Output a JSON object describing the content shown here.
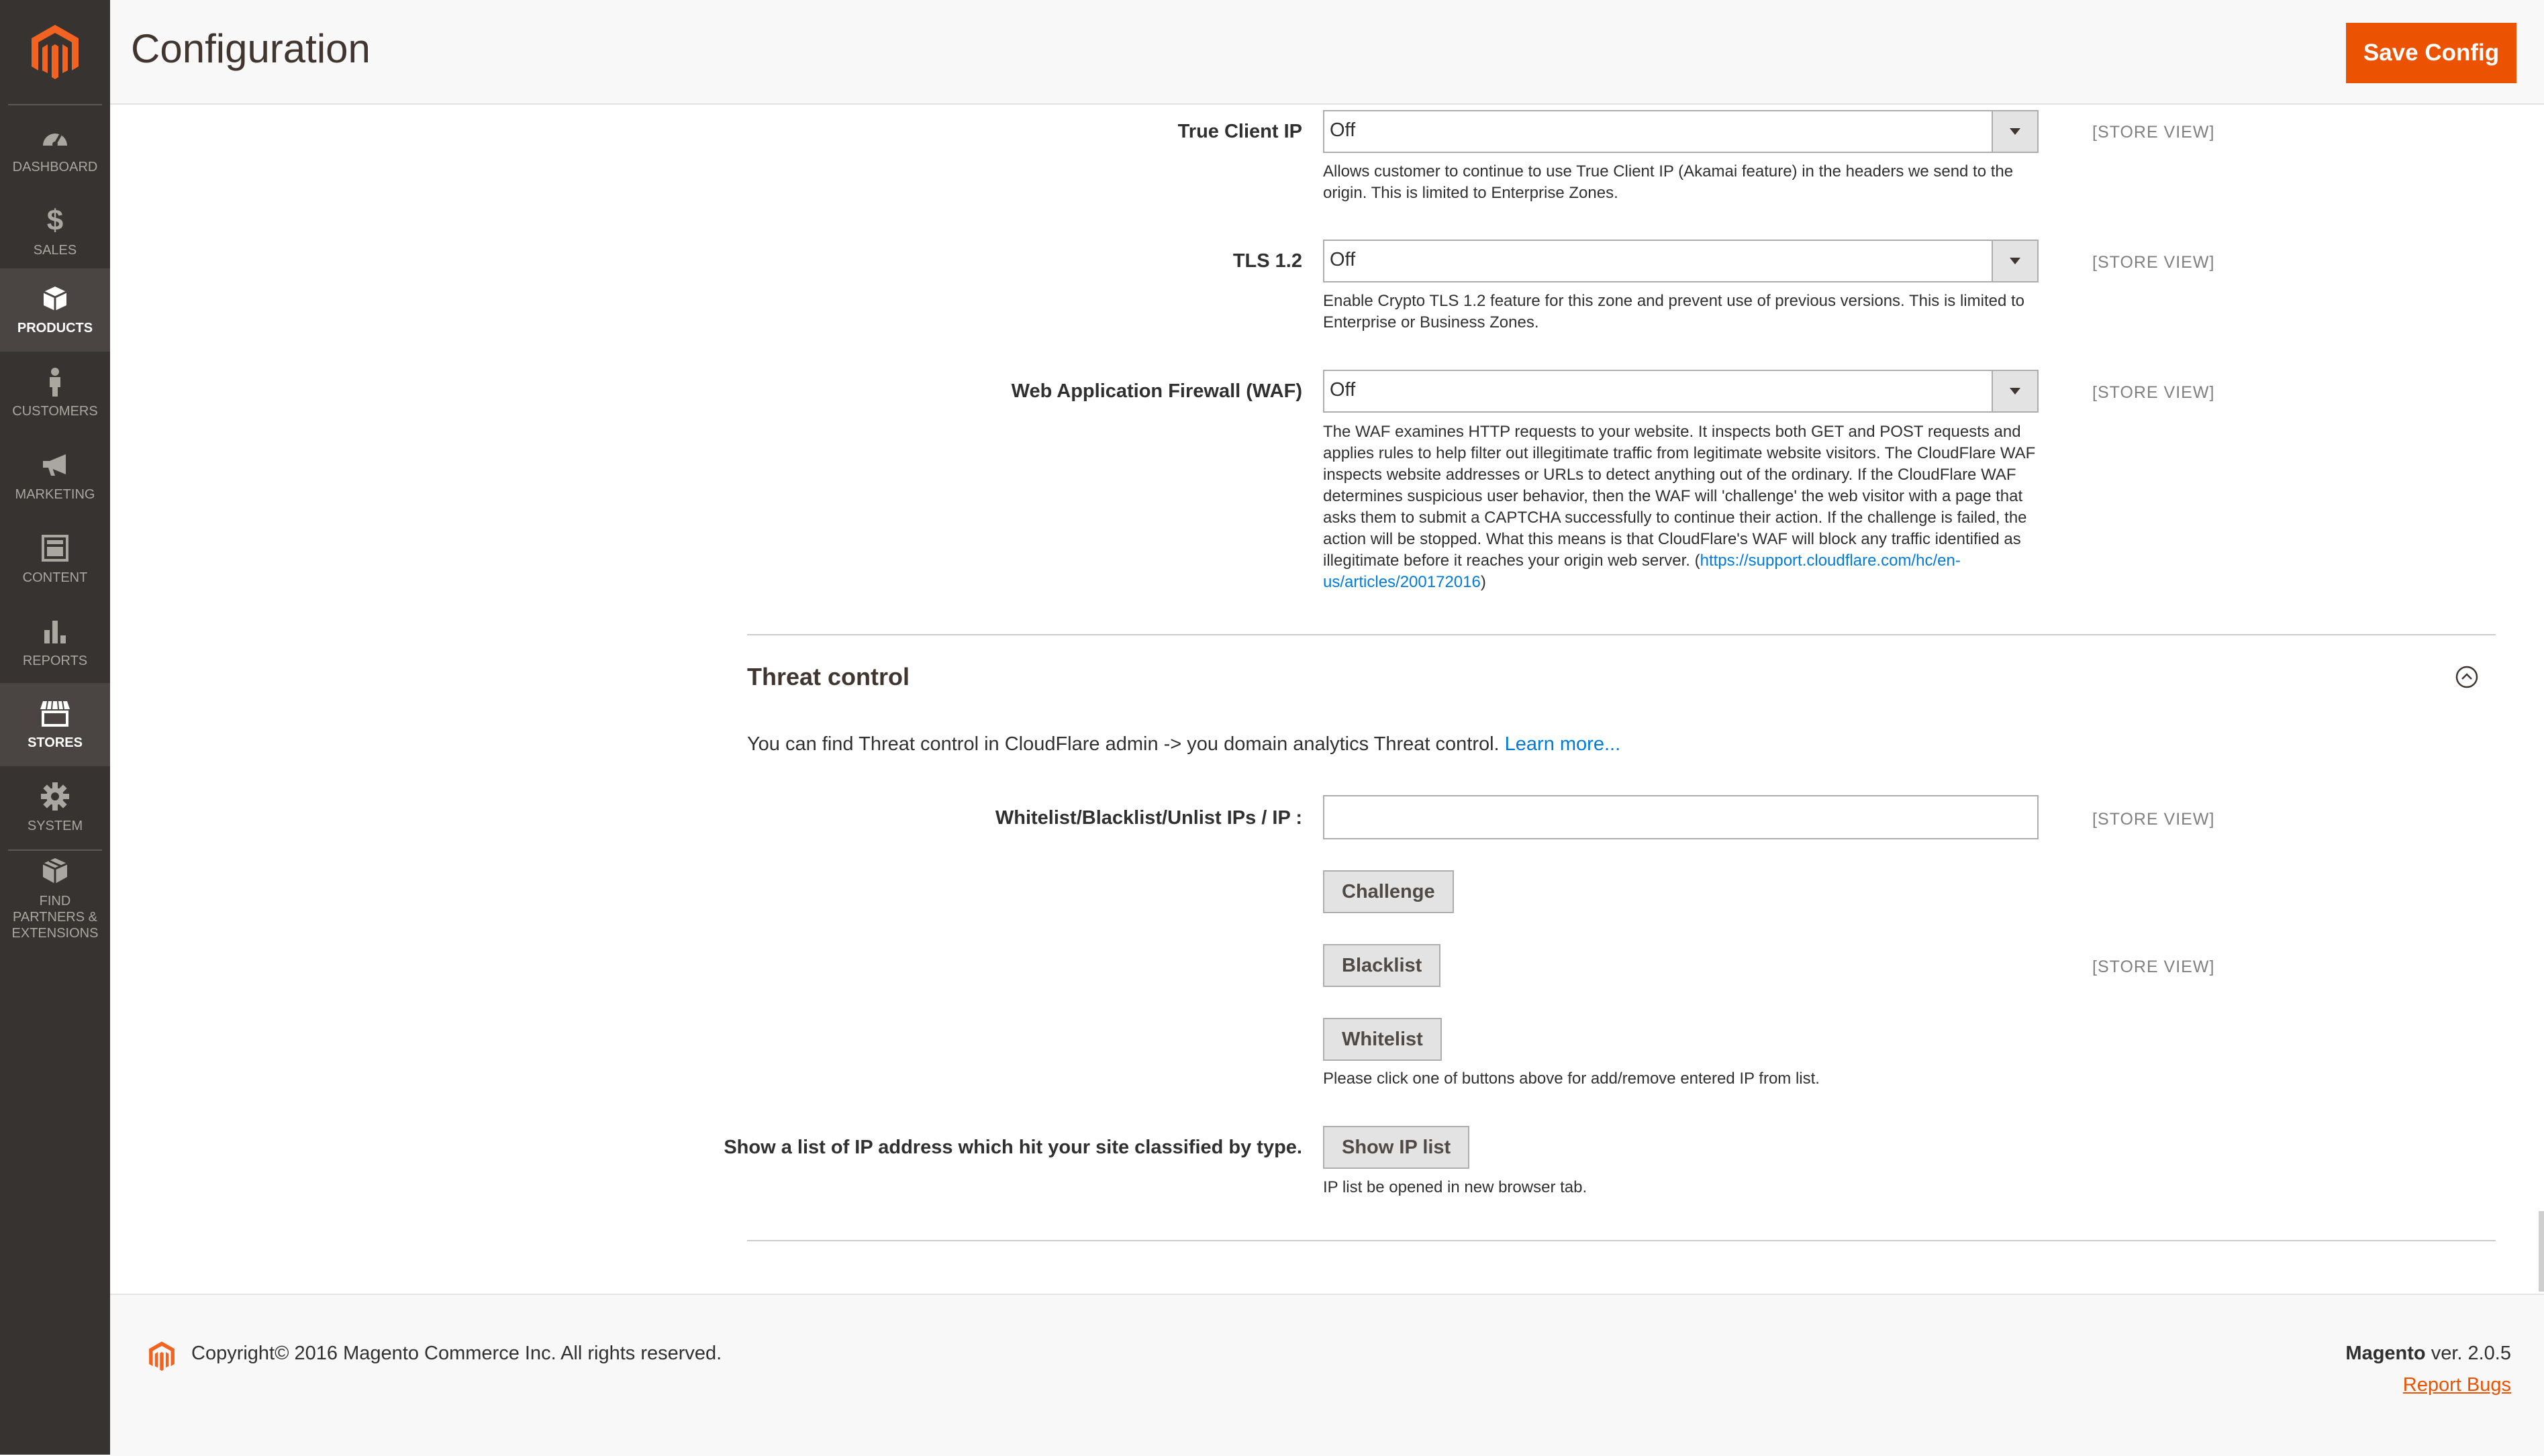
{
  "sidebar": {
    "logo_icon": "magento-logo-icon",
    "items": [
      {
        "label": "DASHBOARD",
        "icon": "dashboard-icon",
        "active": false
      },
      {
        "label": "$",
        "icon": "dollar-icon",
        "active": false
      },
      {
        "label": "SALES",
        "icon": "dollar-icon",
        "active": false
      },
      {
        "label": "PRODUCTS",
        "icon": "box-icon",
        "active": true
      },
      {
        "label": "CUSTOMERS",
        "icon": "person-icon",
        "active": false
      },
      {
        "label": "MARKETING",
        "icon": "megaphone-icon",
        "active": false
      },
      {
        "label": "CONTENT",
        "icon": "layout-icon",
        "active": false
      },
      {
        "label": "REPORTS",
        "icon": "bar-chart-icon",
        "active": false
      },
      {
        "label": "STORES",
        "icon": "storefront-icon",
        "active": true
      },
      {
        "label": "SYSTEM",
        "icon": "gear-icon",
        "active": false
      },
      {
        "label": "FIND PARTNERS & EXTENSIONS",
        "icon": "blocks-icon",
        "active": false
      }
    ]
  },
  "header": {
    "title": "Configuration",
    "save_label": "Save Config",
    "accent": "#eb5202"
  },
  "fields": {
    "true_client_ip": {
      "label": "True Client IP",
      "value": "Off",
      "scope": "[STORE VIEW]",
      "note": "Allows customer to continue to use True Client IP (Akamai feature) in the headers we send to the origin. This is limited to Enterprise Zones."
    },
    "tls": {
      "label": "TLS 1.2",
      "value": "Off",
      "scope": "[STORE VIEW]",
      "note": "Enable Crypto TLS 1.2 feature for this zone and prevent use of previous versions. This is limited to Enterprise or Business Zones."
    },
    "waf": {
      "label": "Web Application Firewall (WAF)",
      "value": "Off",
      "scope": "[STORE VIEW]",
      "note": "The WAF examines HTTP requests to your website. It inspects both GET and POST requests and applies rules to help filter out illegitimate traffic from legitimate website visitors. The CloudFlare WAF inspects website addresses or URLs to detect anything out of the ordinary. If the CloudFlare WAF determines suspicious user behavior, then the WAF will 'challenge' the web visitor with a page that asks them to submit a CAPTCHA successfully to continue their action. If the challenge is failed, the action will be stopped. What this means is that CloudFlare's WAF will block any traffic identified as illegitimate before it reaches your origin web server.",
      "note_open": "(",
      "note_link": "https://support.cloudflare.com/hc/en-us/articles/200172016",
      "note_close": ")"
    }
  },
  "threat": {
    "title": "Threat control",
    "intro": "You can find Threat control in CloudFlare admin -> you domain analytics Threat control.",
    "learn_more": "Learn more...",
    "ip_label": "Whitelist/Blacklist/Unlist IPs / IP :",
    "ip_value": "",
    "ip_scope": "[STORE VIEW]",
    "challenge_label": "Challenge",
    "blacklist_label": "Blacklist",
    "blacklist_scope": "[STORE VIEW]",
    "whitelist_label": "Whitelist",
    "buttons_note": "Please click one of buttons above for add/remove entered IP from list.",
    "list_label": "Show a list of IP address which hit your site classified by type.",
    "show_ip_label": "Show IP list",
    "show_ip_note": "IP list be opened in new browser tab."
  },
  "footer": {
    "copyright": "Copyright© 2016 Magento Commerce Inc. All rights reserved.",
    "brand": "Magento",
    "version": " ver. 2.0.5",
    "report_bugs": "Report Bugs"
  }
}
